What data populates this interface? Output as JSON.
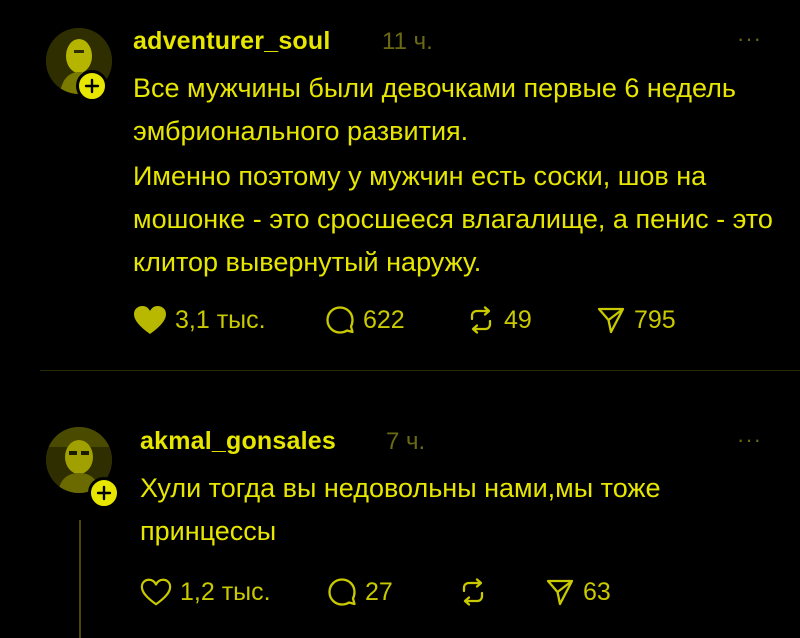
{
  "colors": {
    "accent": "#e6e600",
    "muted": "#6a6a14",
    "background": "#000000"
  },
  "posts": [
    {
      "username": "adventurer_soul",
      "time": "11 ч.",
      "more": "···",
      "paragraphs": [
        "Все мужчины были девочками первые 6 недель эмбрионального развития.",
        "Именно поэтому у мужчин есть соски, шов на мошонке - это сросшееся влагалище, а пенис - это клитор вывернутый наружу."
      ],
      "likes": "3,1 тыс.",
      "liked": true,
      "replies": "622",
      "reposts": "49",
      "shares": "795"
    },
    {
      "username": "akmal_gonsales",
      "time": "7 ч.",
      "more": "···",
      "paragraphs": [
        "Хули тогда вы недовольны нами,мы тоже принцессы"
      ],
      "likes": "1,2 тыс.",
      "liked": false,
      "replies": "27",
      "reposts": "",
      "shares": "63"
    }
  ]
}
